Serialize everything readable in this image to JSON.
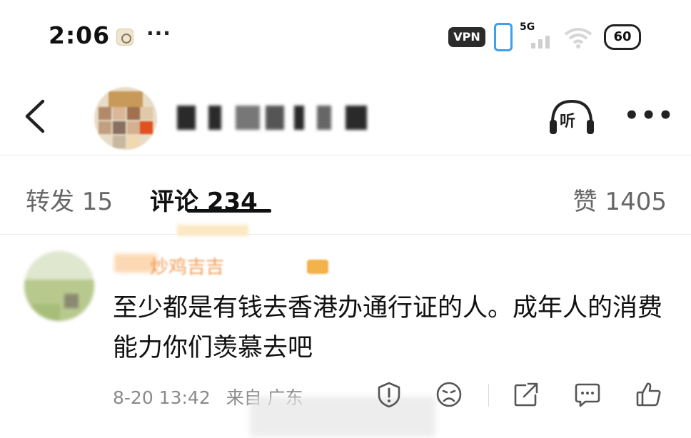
{
  "status_bar": {
    "time": "2:06",
    "more": "···",
    "vpn": "VPN",
    "network": "5G",
    "battery": "60"
  },
  "header": {
    "listen_label": "听",
    "more": "•••"
  },
  "tabs": {
    "repost": "转发 15",
    "comments": "评论 234",
    "likes": "赞 1405"
  },
  "comment": {
    "author": "炒鸡吉吉",
    "text": "至少都是有钱去香港办通行证的人。成年人的消费能力你们羡慕去吧",
    "timestamp": "8-20 13:42",
    "location": "来自 广东",
    "actions": [
      "report-icon",
      "dislike-icon",
      "share-icon",
      "reply-icon",
      "like-icon"
    ]
  },
  "colors": {
    "accent_orange": "#f08c3c",
    "text_primary": "#111111",
    "text_secondary": "#8a8a8a"
  }
}
